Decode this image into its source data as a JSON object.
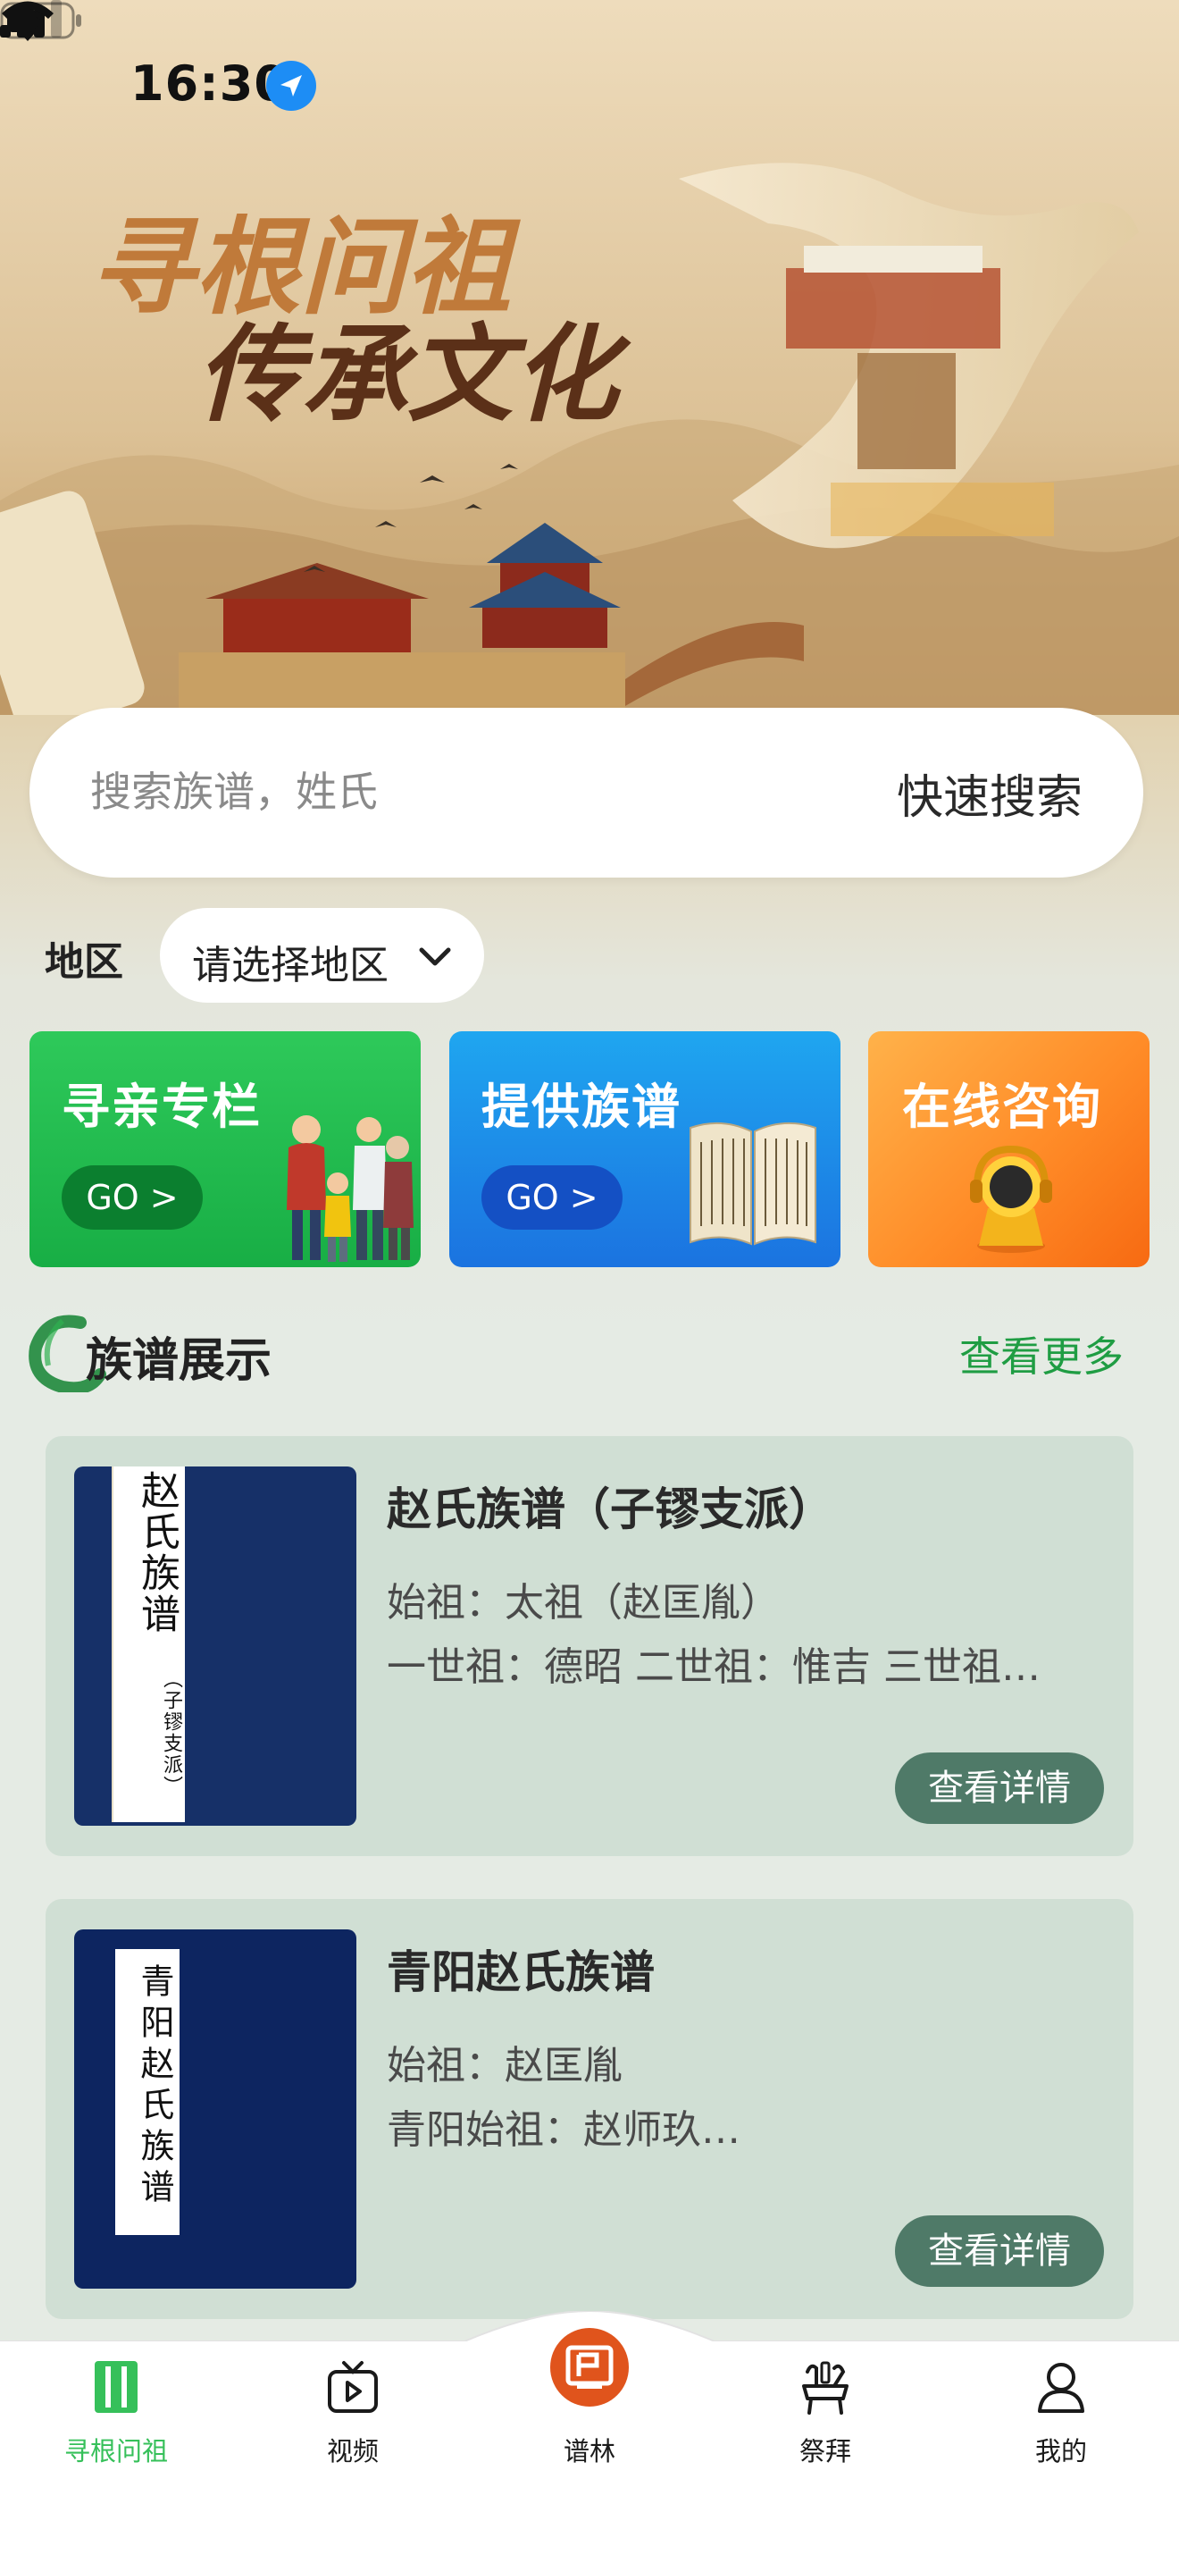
{
  "status_bar": {
    "time": "16:30"
  },
  "banner": {
    "line1": "寻根问祖",
    "line2": "传承文化"
  },
  "search": {
    "placeholder": "搜索族谱，姓氏",
    "button_label": "快速搜索"
  },
  "region": {
    "label": "地区",
    "select_value": "请选择地区"
  },
  "feature_cards": [
    {
      "title": "寻亲专栏",
      "go": "GO >",
      "color": "#1fb84d"
    },
    {
      "title": "提供族谱",
      "go": "GO >",
      "color": "#1c8ce8"
    },
    {
      "title": "在线咨询",
      "color": "#ff8f2b"
    }
  ],
  "section": {
    "title": "族谱展示",
    "more": "查看更多"
  },
  "genealogies": [
    {
      "cover_main": "赵氏族谱",
      "cover_sub": "（子镠支派）",
      "title": "赵氏族谱（子镠支派）",
      "line1": "始祖：太祖（赵匡胤）",
      "line2": "一世祖：德昭 二世祖：惟吉 三世祖…",
      "button": "查看详情"
    },
    {
      "cover_main": "青阳赵氏族谱",
      "title": "青阳赵氏族谱",
      "line1": "始祖：赵匡胤",
      "line2": "青阳始祖：赵师玖…",
      "button": "查看详情"
    }
  ],
  "tab_bar": [
    {
      "label": "寻根问祖",
      "active": true
    },
    {
      "label": "视频"
    },
    {
      "label": "谱林"
    },
    {
      "label": "祭拜"
    },
    {
      "label": "我的"
    }
  ],
  "colors": {
    "accent_green": "#36c05a",
    "button_green": "#4f7a68",
    "link_green": "#1f9d43"
  }
}
